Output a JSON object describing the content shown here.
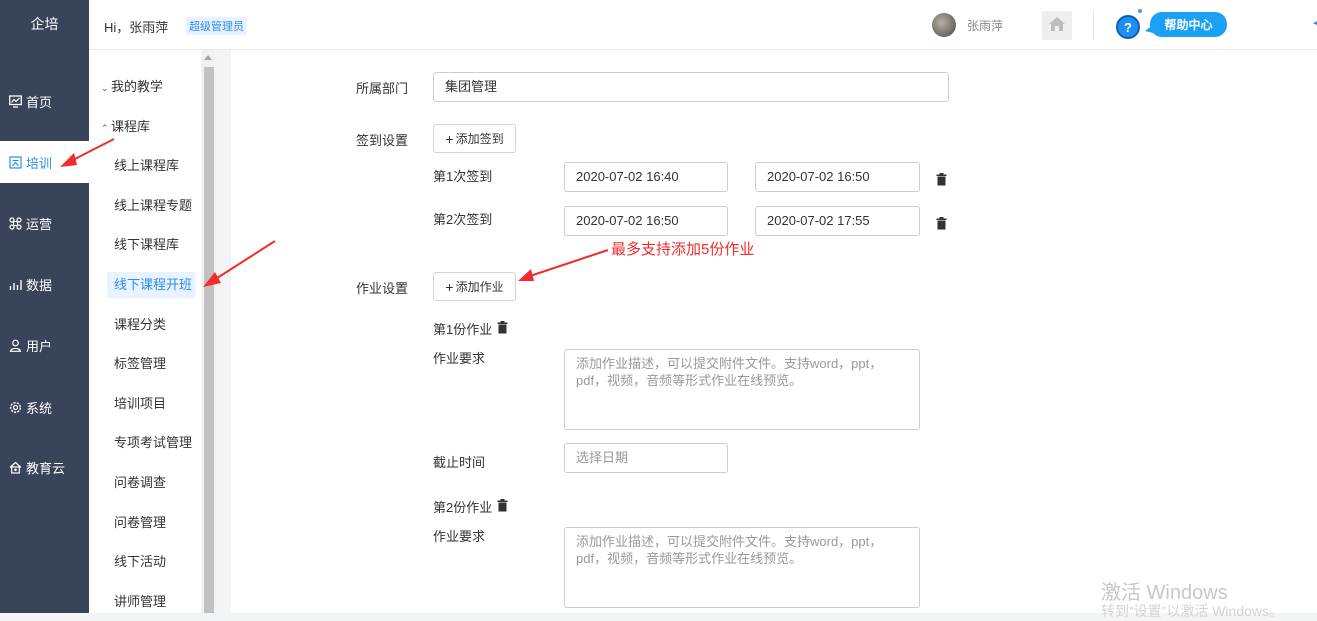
{
  "sidebar": {
    "logo": "企培",
    "items": [
      {
        "label": "首页",
        "icon": "dashboard-icon"
      },
      {
        "label": "培训",
        "icon": "training-icon",
        "active": true
      },
      {
        "label": "运营",
        "icon": "command-icon"
      },
      {
        "label": "数据",
        "icon": "chart-icon"
      },
      {
        "label": "用户",
        "icon": "user-icon"
      },
      {
        "label": "系统",
        "icon": "gear-icon"
      },
      {
        "label": "教育云",
        "icon": "cloud-home-icon"
      }
    ]
  },
  "header": {
    "greeting": "Hi，张雨萍",
    "role": "超级管理员",
    "username": "张雨萍",
    "help_label": "帮助中心"
  },
  "submenu": {
    "groups": [
      {
        "label": "我的教学",
        "expanded": false
      },
      {
        "label": "课程库",
        "expanded": true
      }
    ],
    "items": [
      {
        "label": "线上课程库"
      },
      {
        "label": "线上课程专题"
      },
      {
        "label": "线下课程库"
      },
      {
        "label": "线下课程开班",
        "active": true
      },
      {
        "label": "课程分类"
      },
      {
        "label": "标签管理"
      },
      {
        "label": "培训项目"
      },
      {
        "label": "专项考试管理"
      },
      {
        "label": "问卷调查"
      },
      {
        "label": "问卷管理"
      },
      {
        "label": "线下活动"
      },
      {
        "label": "讲师管理"
      }
    ]
  },
  "form": {
    "dept_label": "所属部门",
    "dept_value": "集团管理",
    "checkin_label": "签到设置",
    "add_checkin_label": "添加签到",
    "checkins": [
      {
        "label": "第1次签到",
        "start": "2020-07-02 16:40",
        "end": "2020-07-02 16:50"
      },
      {
        "label": "第2次签到",
        "start": "2020-07-02 16:50",
        "end": "2020-07-02 17:55"
      }
    ],
    "homework_label": "作业设置",
    "add_homework_label": "添加作业",
    "homeworks": [
      {
        "title": "第1份作业",
        "req_label": "作业要求",
        "placeholder": "添加作业描述，可以提交附件文件。支持word，ppt，pdf，视频，音频等形式作业在线预览。",
        "deadline_label": "截止时间",
        "deadline_placeholder": "选择日期"
      },
      {
        "title": "第2份作业",
        "req_label": "作业要求",
        "placeholder": "添加作业描述，可以提交附件文件。支持word，ppt，pdf，视频，音频等形式作业在线预览。"
      }
    ]
  },
  "annotation": "最多支持添加5份作业",
  "watermark": {
    "line1": "激活 Windows",
    "line2": "转到“设置”以激活 Windows。"
  },
  "colors": {
    "sidebar_bg": "#37445a",
    "accent": "#2d8cf0",
    "annotation": "#f22b2b",
    "help_pill": "#1aa1f5"
  }
}
